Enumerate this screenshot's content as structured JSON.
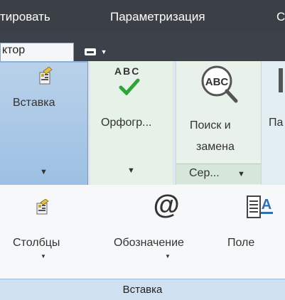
{
  "menubar": {
    "items": [
      "тировать",
      "Параметризация",
      "С"
    ]
  },
  "tabs": {
    "active": "ктор",
    "icon_label": "▼"
  },
  "ribbon_top": {
    "vstavka": {
      "label": "Вставка"
    },
    "orfo": {
      "icon_text": "ABC",
      "label": "Орфогр..."
    },
    "search": {
      "label_line1": "Поиск и",
      "label_line2": "замена",
      "panel_label": "Сер..."
    },
    "pa": {
      "label": "Па"
    }
  },
  "ribbon_mid": {
    "columns": {
      "label": "Столбцы"
    },
    "designation": {
      "label": "Обозначение"
    },
    "field": {
      "label": "Поле"
    }
  },
  "footer": {
    "panel_title": "Вставка"
  },
  "colors": {
    "menubar": "#3b3f46",
    "check_green": "#2fa535",
    "group_selected": "#9cc0e3"
  }
}
